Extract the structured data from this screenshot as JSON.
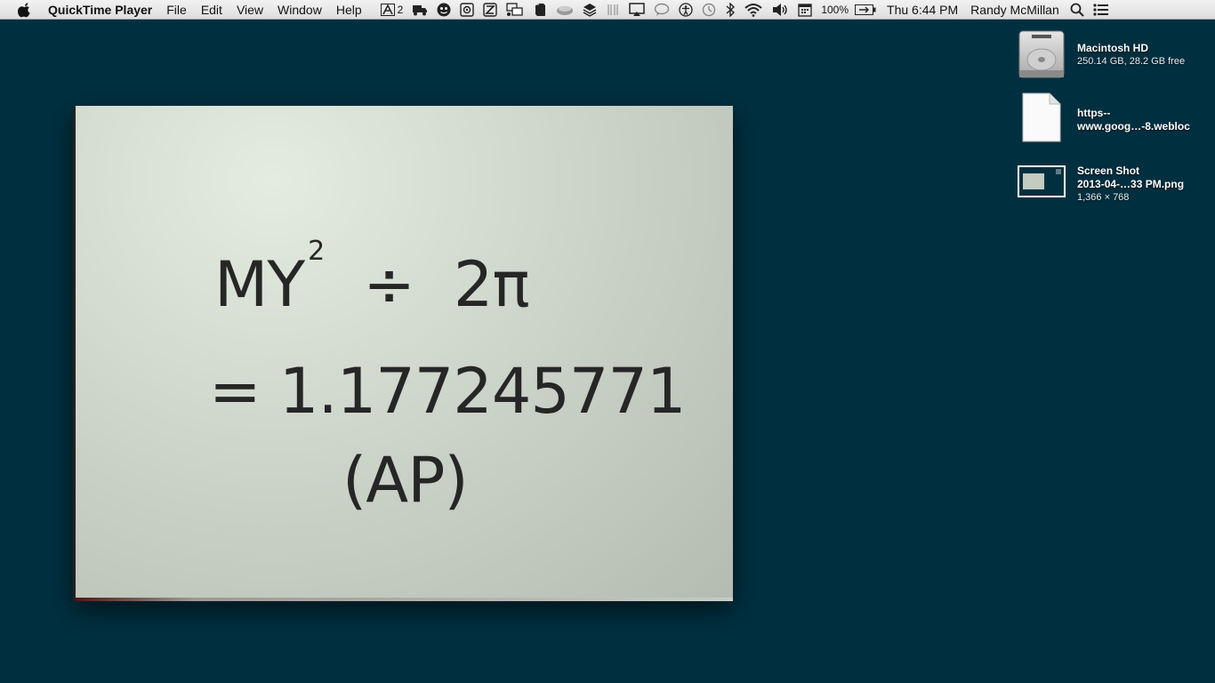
{
  "menubar": {
    "app_name": "QuickTime Player",
    "menus": [
      "File",
      "Edit",
      "View",
      "Window",
      "Help"
    ],
    "status": {
      "adobe_count": "2",
      "battery_percent": "100%",
      "clock": "Thu 6:44 PM",
      "user": "Randy McMillan"
    }
  },
  "video": {
    "line1_base": "MY",
    "line1_exp": "2",
    "line1_op": "÷",
    "line1_rhs": "2π",
    "line2": "= 1.177245771",
    "line3": "(AP)"
  },
  "desktop": {
    "items": [
      {
        "name": "Macintosh HD",
        "detail": "250.14 GB, 28.2 GB free",
        "icon": "hard-drive-icon"
      },
      {
        "name_line1": "https--",
        "name_line2": "www.goog…-8.webloc",
        "icon": "document-icon"
      },
      {
        "name_line1": "Screen Shot",
        "name_line2": "2013-04-…33 PM.png",
        "detail": "1,366 × 768",
        "icon": "image-thumbnail-icon"
      }
    ]
  },
  "colors": {
    "desktop_background": "#003040",
    "menubar": "#e6e6e6"
  }
}
